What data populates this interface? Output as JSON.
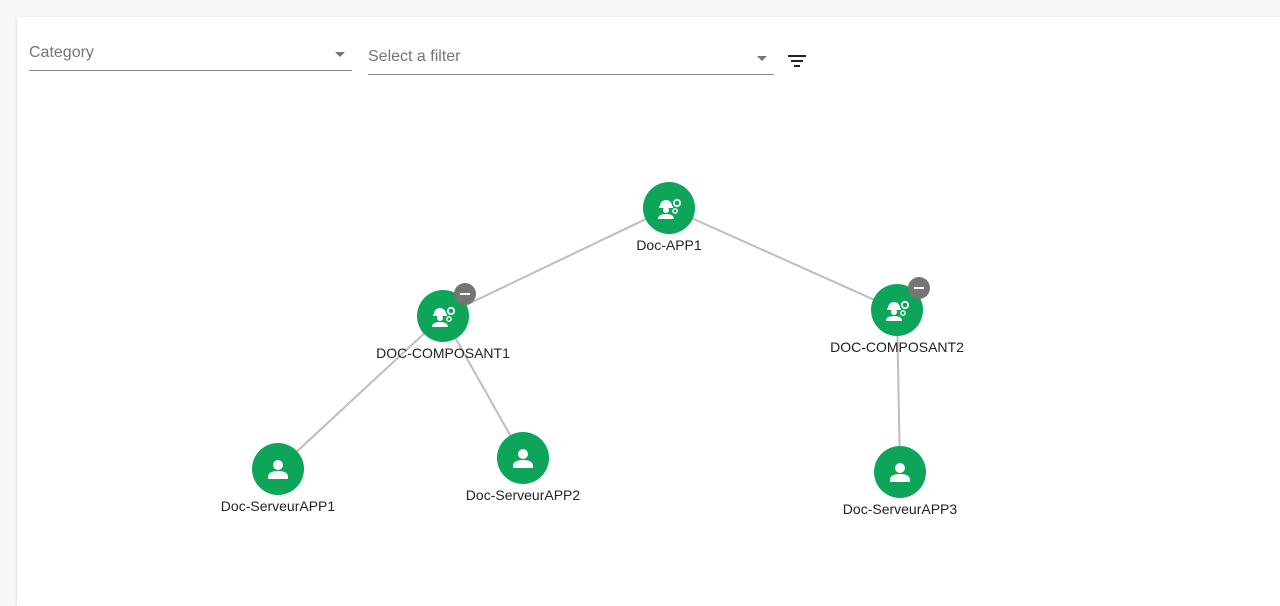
{
  "filters": {
    "category_label": "Category",
    "filter_placeholder": "Select a filter",
    "filter_icon": "filter-list-icon"
  },
  "colors": {
    "node": "#0ca55a",
    "edge": "#bdbdbd",
    "collapse_badge": "#757575",
    "text": "#222222"
  },
  "graph": {
    "nodes": [
      {
        "id": "app1",
        "label": "Doc-APP1",
        "icon": "engineering-icon",
        "collapsible": false
      },
      {
        "id": "comp1",
        "label": "DOC-COMPOSANT1",
        "icon": "engineering-icon",
        "collapsible": true
      },
      {
        "id": "comp2",
        "label": "DOC-COMPOSANT2",
        "icon": "engineering-icon",
        "collapsible": true
      },
      {
        "id": "srv1",
        "label": "Doc-ServeurAPP1",
        "icon": "person-icon",
        "collapsible": false
      },
      {
        "id": "srv2",
        "label": "Doc-ServeurAPP2",
        "icon": "person-icon",
        "collapsible": false
      },
      {
        "id": "srv3",
        "label": "Doc-ServeurAPP3",
        "icon": "person-icon",
        "collapsible": false
      }
    ],
    "edges": [
      {
        "from": "app1",
        "to": "comp1"
      },
      {
        "from": "app1",
        "to": "comp2"
      },
      {
        "from": "comp1",
        "to": "srv1"
      },
      {
        "from": "comp1",
        "to": "srv2"
      },
      {
        "from": "comp2",
        "to": "srv3"
      }
    ]
  }
}
